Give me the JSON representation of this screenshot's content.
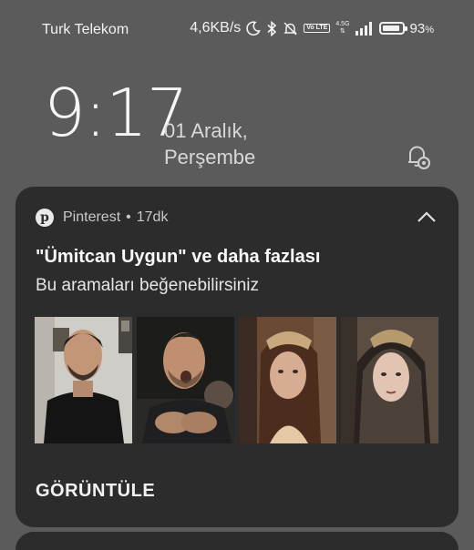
{
  "status_bar": {
    "carrier": "Turk Telekom",
    "speed": "4,6KB/s",
    "volte": "Vo LTE",
    "network_type": "4.5G",
    "battery_percent": "93",
    "battery_level": 0.93,
    "percent_sign": "%"
  },
  "lockscreen": {
    "time": "9:17",
    "date_line1": "01 Aralık,",
    "date_line2": "Perşembe"
  },
  "notification": {
    "app_name": "Pinterest",
    "separator": "•",
    "time_ago": "17dk",
    "title": "\"Ümitcan Uygun\" ve daha fazlası",
    "body": "Bu aramaları beğenebilirsiniz",
    "action_label": "GÖRÜNTÜLE",
    "images": [
      "image-man-black-shirt",
      "image-man-singing",
      "image-woman-crown",
      "image-woman-veil"
    ]
  }
}
